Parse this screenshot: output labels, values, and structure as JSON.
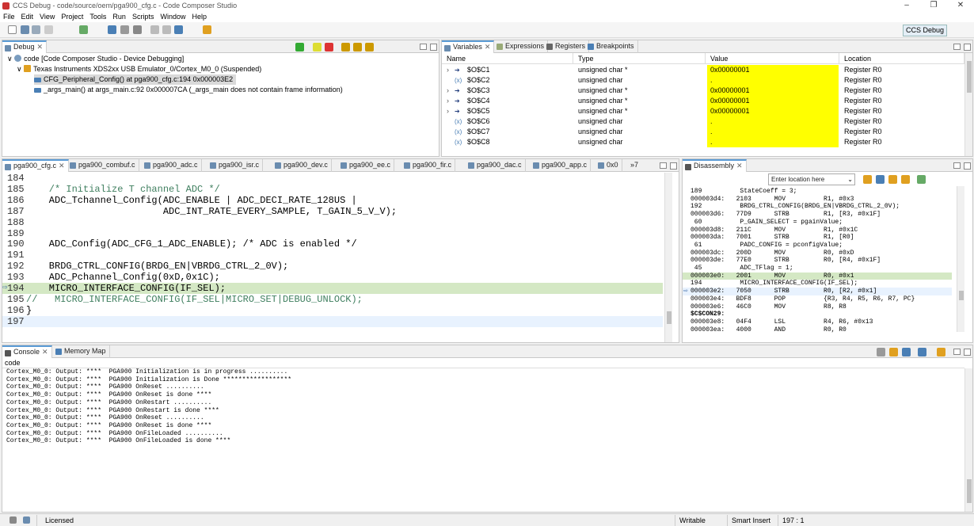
{
  "window": {
    "title": "CCS Debug - code/source/oem/pga900_cfg.c - Code Composer Studio",
    "controls": [
      "–",
      "❐",
      "✕"
    ]
  },
  "menu": [
    "File",
    "Edit",
    "View",
    "Project",
    "Tools",
    "Run",
    "Scripts",
    "Window",
    "Help"
  ],
  "perspective": {
    "label": "CCS Debug"
  },
  "debug": {
    "tab": "Debug",
    "items": [
      "code [Code Composer Studio - Device Debugging]",
      "Texas Instruments XDS2xx USB Emulator_0/Cortex_M0_0 (Suspended)",
      "CFG_Peripheral_Config() at pga900_cfg.c:194 0x000003E2",
      "_args_main() at args_main.c:92 0x000007CA  (_args_main does not contain frame information)"
    ]
  },
  "views": {
    "tabs": [
      "Variables",
      "Expressions",
      "Registers",
      "Breakpoints"
    ],
    "columns": [
      "Name",
      "Type",
      "Value",
      "Location"
    ],
    "rows": [
      {
        "name": "$O$C1",
        "type": "unsigned char *",
        "value": "0x00000001",
        "location": "Register R0"
      },
      {
        "name": "$O$C2",
        "type": "unsigned char",
        "value": ".",
        "location": "Register R0"
      },
      {
        "name": "$O$C3",
        "type": "unsigned char *",
        "value": "0x00000001",
        "location": "Register R0"
      },
      {
        "name": "$O$C4",
        "type": "unsigned char *",
        "value": "0x00000001",
        "location": "Register R0"
      },
      {
        "name": "$O$C5",
        "type": "unsigned char *",
        "value": "0x00000001",
        "location": "Register R0"
      },
      {
        "name": "$O$C6",
        "type": "unsigned char",
        "value": ".",
        "location": "Register R0"
      },
      {
        "name": "$O$C7",
        "type": "unsigned char",
        "value": ".",
        "location": "Register R0"
      },
      {
        "name": "$O$C8",
        "type": "unsigned char",
        "value": ".",
        "location": "Register R0"
      }
    ],
    "value_highlight": "#ffff00"
  },
  "editor": {
    "tabs": [
      "pga900_cfg.c",
      "pga900_combuf.c",
      "pga900_adc.c",
      "pga900_isr.c",
      "pga900_dev.c",
      "pga900_ee.c",
      "pga900_fir.c",
      "pga900_dac.c",
      "pga900_app.c",
      "0x0",
      "»7"
    ],
    "lines": [
      {
        "n": "184",
        "t": ""
      },
      {
        "n": "185",
        "t": "    /* Initialize T channel ADC */"
      },
      {
        "n": "186",
        "t": "    ADC_Tchannel_Config(ADC_ENABLE | ADC_DECI_RATE_128US |"
      },
      {
        "n": "187",
        "t": "                        ADC_INT_RATE_EVERY_SAMPLE, T_GAIN_5_V_V);"
      },
      {
        "n": "188",
        "t": ""
      },
      {
        "n": "189",
        "t": ""
      },
      {
        "n": "190",
        "t": "    ADC_Config(ADC_CFG_1_ADC_ENABLE); /* ADC is enabled */"
      },
      {
        "n": "191",
        "t": ""
      },
      {
        "n": "192",
        "t": "    BRDG_CTRL_CONFIG(BRDG_EN|VBRDG_CTRL_2_0V);"
      },
      {
        "n": "193",
        "t": "    ADC_Pchannel_Config(0xD,0x1C);"
      },
      {
        "n": "194",
        "t": "    MICRO_INTERFACE_CONFIG(IF_SEL);"
      },
      {
        "n": "195",
        "t": "//   MICRO_INTERFACE_CONFIG(IF_SEL|MICRO_SET|DEBUG_UNLOCK);"
      },
      {
        "n": "196",
        "t": "}"
      },
      {
        "n": "197",
        "t": ""
      }
    ]
  },
  "disassembly": {
    "tab": "Disassembly",
    "location_placeholder": "Enter location here",
    "lines": [
      "189          StateCoeff = 3;",
      "000003d4:   2103      MOV          R1, #0x3",
      "192          BRDG_CTRL_CONFIG(BRDG_EN|VBRDG_CTRL_2_0V);",
      "000003d6:   77D9      STRB         R1, [R3, #0x1F]",
      " 60          P_GAIN_SELECT = pgainValue;",
      "000003d8:   211C      MOV          R1, #0x1C",
      "000003da:   7001      STRB         R1, [R0]",
      " 61          PADC_CONFIG = pconfigValue;",
      "000003dc:   200D      MOV          R0, #0xD",
      "000003de:   77E0      STRB         R0, [R4, #0x1F]",
      " 45          ADC_TFlag = 1;",
      "000003e0:   2001      MOV          R0, #0x1",
      "194          MICRO_INTERFACE_CONFIG(IF_SEL);",
      "000003e2:   7050      STRB         R0, [R2, #0x1]",
      "000003e4:   BDF8      POP          {R3, R4, R5, R6, R7, PC}",
      "000003e6:   46C0      MOV          R8, R8",
      "$C$CON29:",
      "000003e8:   04F4      LSL          R4, R6, #0x13",
      "000003ea:   4000      AND          R0, R0"
    ]
  },
  "console": {
    "tabs": [
      "Console",
      "Memory Map"
    ],
    "name": "code",
    "lines": [
      "Cortex_M0_0: Output: ****  PGA900 Initialization is in progress ..........",
      "Cortex_M0_0: Output: ****  PGA900 Initialization is Done ******************",
      "Cortex_M0_0: Output: ****  PGA900 OnReset ..........",
      "Cortex_M0_0: Output: ****  PGA900 OnReset is done ****",
      "Cortex_M0_0: Output: ****  PGA900 OnRestart ..........",
      "Cortex_M0_0: Output: ****  PGA900 OnRestart is done ****",
      "Cortex_M0_0: Output: ****  PGA900 OnReset ..........",
      "Cortex_M0_0: Output: ****  PGA900 OnReset is done ****",
      "Cortex_M0_0: Output: ****  PGA900 OnFileLoaded ..........",
      "Cortex_M0_0: Output: ****  PGA900 OnFileLoaded is done ****"
    ]
  },
  "status": {
    "license": "Licensed",
    "writable": "Writable",
    "insert": "Smart Insert",
    "position": "197 : 1"
  }
}
